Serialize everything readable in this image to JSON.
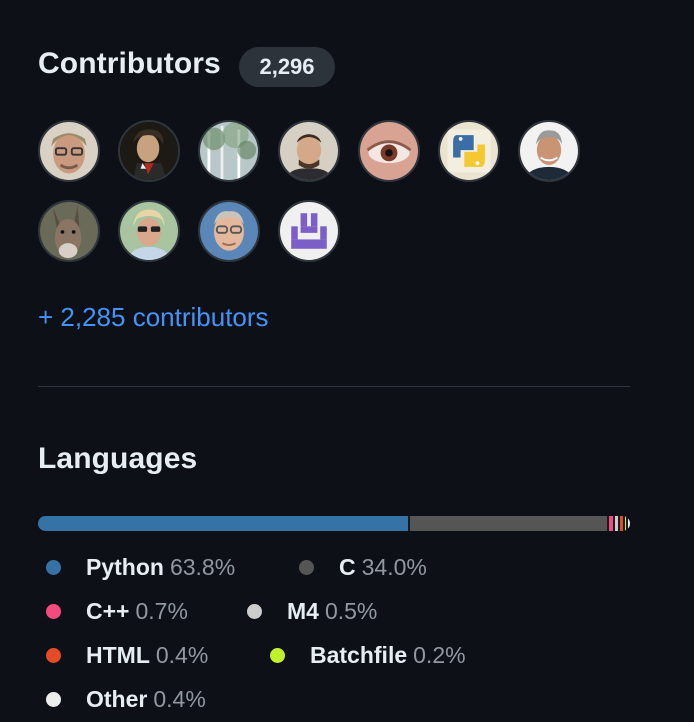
{
  "contributors": {
    "title": "Contributors",
    "count": "2,296",
    "more_link": "+ 2,285 contributors",
    "avatars": [
      {
        "icon": "avatar-glasses-man"
      },
      {
        "icon": "avatar-beethoven-portrait"
      },
      {
        "icon": "avatar-trees"
      },
      {
        "icon": "avatar-smiling-man"
      },
      {
        "icon": "avatar-eye-closeup"
      },
      {
        "icon": "avatar-python-logo"
      },
      {
        "icon": "avatar-gray-haired-man"
      },
      {
        "icon": "avatar-donkey"
      },
      {
        "icon": "avatar-woman-sunglasses"
      },
      {
        "icon": "avatar-older-man-glasses"
      },
      {
        "icon": "avatar-purple-identicon"
      }
    ]
  },
  "languages": {
    "title": "Languages",
    "items": [
      {
        "name": "Python",
        "percent": "63.8%",
        "color": "#3572A5"
      },
      {
        "name": "C",
        "percent": "34.0%",
        "color": "#555555"
      },
      {
        "name": "C++",
        "percent": "0.7%",
        "color": "#f34b7d"
      },
      {
        "name": "M4",
        "percent": "0.5%",
        "color": "#cccccc"
      },
      {
        "name": "HTML",
        "percent": "0.4%",
        "color": "#e34c26"
      },
      {
        "name": "Batchfile",
        "percent": "0.2%",
        "color": "#C1F12E"
      },
      {
        "name": "Other",
        "percent": "0.4%",
        "color": "#ededed"
      }
    ]
  }
}
